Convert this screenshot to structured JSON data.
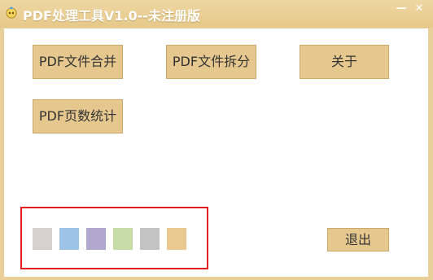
{
  "window": {
    "title": "PDF处理工具V1.0--未注册版",
    "minimize_glyph": "—",
    "close_glyph": "✕"
  },
  "main": {
    "merge_label": "PDF文件合并",
    "split_label": "PDF文件拆分",
    "about_label": "关于",
    "page_count_label": "PDF页数统计",
    "exit_label": "退出"
  },
  "theme_swatches": [
    {
      "color": "#d6d1cb"
    },
    {
      "color": "#9dc3e6"
    },
    {
      "color": "#b2a7cf"
    },
    {
      "color": "#c6dba6"
    },
    {
      "color": "#c3c3c3"
    },
    {
      "color": "#e9c98f"
    }
  ],
  "colors": {
    "titlebar": "#e9cf9a",
    "button_fill": "#e6c88f",
    "highlight_border": "#e02020"
  }
}
